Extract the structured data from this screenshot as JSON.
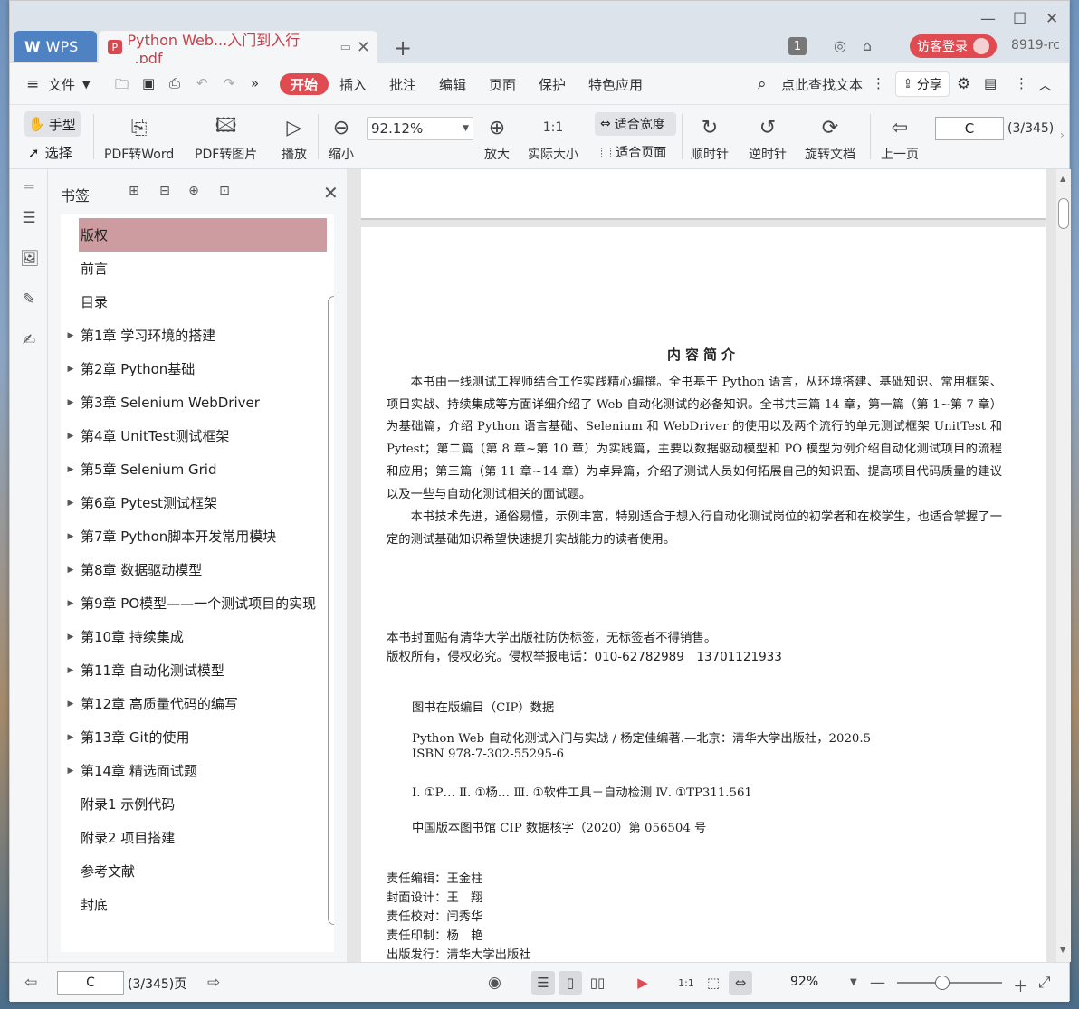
{
  "titlebar": {
    "wps_tab": "WPS",
    "doc_tab": "Python Web...入门到入行_.pdf",
    "page_count_badge": "1",
    "login": "访客登录",
    "user_id": "8919-rc"
  },
  "menubar": {
    "file": "文件",
    "items": [
      "开始",
      "插入",
      "批注",
      "编辑",
      "页面",
      "保护",
      "特色应用"
    ],
    "search": "点此查找文本",
    "share": "分享"
  },
  "toolbar": {
    "hand": "手型",
    "select": "选择",
    "pdf_to_word": "PDF转Word",
    "pdf_to_image": "PDF转图片",
    "play": "播放",
    "zoom_out": "缩小",
    "zoom_value": "92.12%",
    "zoom_in": "放大",
    "actual_size": "实际大小",
    "fit_width": "适合宽度",
    "fit_page": "适合页面",
    "clockwise": "顺时针",
    "counterclockwise": "逆时针",
    "rotate_doc": "旋转文档",
    "prev_page": "上一页",
    "page_input": "C",
    "page_total": "(3/345)"
  },
  "bookmarks": {
    "title": "书签",
    "items": [
      {
        "label": "版权",
        "expandable": false,
        "active": true
      },
      {
        "label": "前言",
        "expandable": false
      },
      {
        "label": "目录",
        "expandable": false
      },
      {
        "label": "第1章 学习环境的搭建",
        "expandable": true
      },
      {
        "label": "第2章 Python基础",
        "expandable": true
      },
      {
        "label": "第3章 Selenium WebDriver",
        "expandable": true
      },
      {
        "label": "第4章 UnitTest测试框架",
        "expandable": true
      },
      {
        "label": "第5章 Selenium Grid",
        "expandable": true
      },
      {
        "label": "第6章 Pytest测试框架",
        "expandable": true
      },
      {
        "label": "第7章 Python脚本开发常用模块",
        "expandable": true
      },
      {
        "label": "第8章 数据驱动模型",
        "expandable": true
      },
      {
        "label": "第9章 PO模型——一个测试项目的实现",
        "expandable": true
      },
      {
        "label": "第10章 持续集成",
        "expandable": true
      },
      {
        "label": "第11章 自动化测试模型",
        "expandable": true
      },
      {
        "label": "第12章 高质量代码的编写",
        "expandable": true
      },
      {
        "label": "第13章 Git的使用",
        "expandable": true
      },
      {
        "label": "第14章 精选面试题",
        "expandable": true
      },
      {
        "label": "附录1 示例代码",
        "expandable": false
      },
      {
        "label": "附录2 项目搭建",
        "expandable": false
      },
      {
        "label": "参考文献",
        "expandable": false
      },
      {
        "label": "封底",
        "expandable": false
      }
    ]
  },
  "page": {
    "title": "内容简介",
    "para1": "本书由一线测试工程师结合工作实践精心编撰。全书基于 Python 语言，从环境搭建、基础知识、常用框架、项目实战、持续集成等方面详细介绍了 Web 自动化测试的必备知识。全书共三篇 14 章，第一篇（第 1~第 7 章）为基础篇，介绍 Python 语言基础、Selenium 和 WebDriver 的使用以及两个流行的单元测试框架 UnitTest 和 Pytest；第二篇（第 8 章~第 10 章）为实践篇，主要以数据驱动模型和 PO 模型为例介绍自动化测试项目的流程和应用；第三篇（第 11 章~14 章）为卓异篇，介绍了测试人员如何拓展自己的知识面、提高项目代码质量的建议以及一些与自动化测试相关的面试题。",
    "para2": "本书技术先进，通俗易懂，示例丰富，特别适合于想入行自动化测试岗位的初学者和在校学生，也适合掌握了一定的测试基础知识希望快速提升实战能力的读者使用。",
    "notice1": "本书封面贴有清华大学出版社防伪标签，无标签者不得销售。",
    "notice2": "版权所有，侵权必究。侵权举报电话：010-62782989　13701121933",
    "cip_title": "图书在版编目（CIP）数据",
    "cip1": "Python Web 自动化测试入门与实战 / 杨定佳编著.—北京：清华大学出版社，2020.5",
    "cip2": "ISBN 978-7-302-55295-6",
    "cip3": "Ⅰ. ①P… Ⅱ. ①杨… Ⅲ. ①软件工具－自动检测 Ⅳ. ①TP311.561",
    "cip4": "中国版本图书馆 CIP 数据核字（2020）第 056504 号",
    "credits": [
      "责任编辑：王金柱",
      "封面设计：王　翔",
      "责任校对：闫秀华",
      "责任印制：杨　艳",
      "出版发行：清华大学出版社"
    ]
  },
  "statusbar": {
    "page_input": "C",
    "pages": "(3/345)页",
    "zoom": "92%"
  },
  "colors": {
    "accent": "#e04b52",
    "active_bookmark": "#cc9ca1",
    "wps_tab": "#4f82c2"
  }
}
